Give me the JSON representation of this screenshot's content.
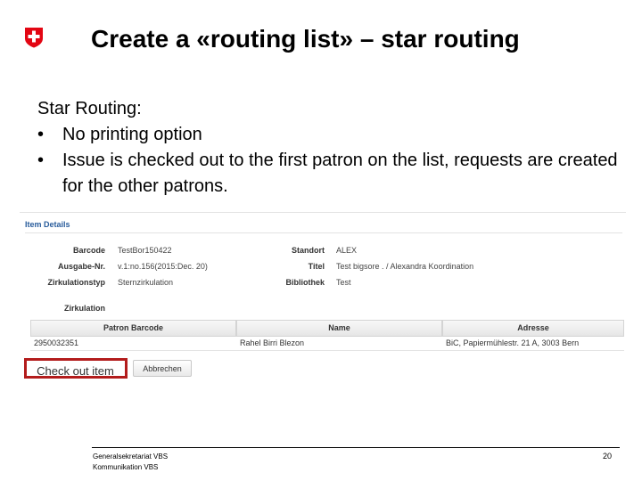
{
  "slide": {
    "title": "Create a «routing list» – star routing",
    "intro": "Star Routing:",
    "bullets": [
      "No printing option",
      "Issue is checked out to the first patron on the list, requests are created for the other patrons."
    ],
    "bullet_glyph": "•"
  },
  "screenshot": {
    "section_title": "Item Details",
    "fields": {
      "barcode_label": "Barcode",
      "barcode_value": "TestBor150422",
      "ausgabe_label": "Ausgabe-Nr.",
      "ausgabe_value": "v.1:no.156(2015:Dec. 20)",
      "zirkulationstyp_label": "Zirkulationstyp",
      "zirkulationstyp_value": "Sternzirkulation",
      "standort_label": "Standort",
      "standort_value": "ALEX",
      "titel_label": "Titel",
      "titel_value": "Test bigsore . / Alexandra Koordination",
      "bibliothek_label": "Bibliothek",
      "bibliothek_value": "Test"
    },
    "zirkulation_title": "Zirkulation",
    "table": {
      "headers": [
        "Patron Barcode",
        "Name",
        "Adresse"
      ],
      "rows": [
        [
          "2950032351",
          "Rahel Birri Blezon",
          "BiC, Papiermühlestr. 21 A, 3003 Bern"
        ]
      ]
    },
    "checkout_button": "Check out item",
    "cancel_button": "Abbrechen"
  },
  "footer": {
    "org_line1": "Generalsekretariat VBS",
    "org_line2": "Kommunikation VBS",
    "page_number": "20"
  },
  "colors": {
    "flag_red": "#e30613",
    "highlight_red": "#b31c1c",
    "section_title_blue": "#2a5d9c"
  },
  "icons": {
    "logo": "swiss-cross-icon"
  }
}
